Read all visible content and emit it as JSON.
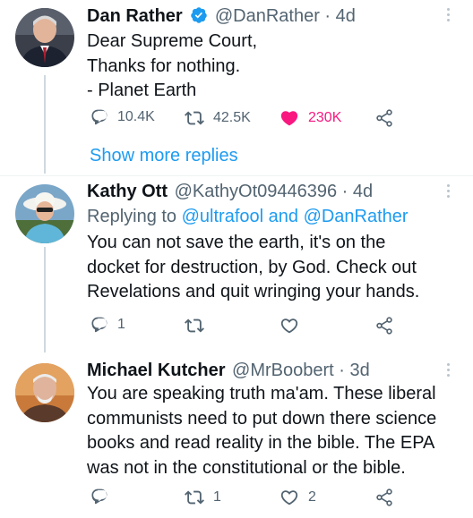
{
  "tweets": [
    {
      "name": "Dan Rather",
      "verified": true,
      "handle": "@DanRather",
      "time": "· 4d",
      "lines": [
        "Dear Supreme Court,",
        "Thanks for nothing.",
        "- Planet Earth"
      ],
      "actions": {
        "reply": "10.4K",
        "retweet": "42.5K",
        "like": "230K"
      },
      "like_active": true
    },
    {
      "name": "Kathy Ott",
      "handle": "@KathyOt09446396",
      "time": "· 4d",
      "replying_prefix": "Replying to",
      "replying_targets": "@ultrafool and @DanRather",
      "lines": [
        "You can not save the earth, it's on the",
        "docket for destruction, by God. Check out",
        "Revelations and quit wringing your hands."
      ],
      "actions": {
        "reply": "1",
        "retweet": "",
        "like": ""
      }
    },
    {
      "name": "Michael Kutcher",
      "handle": "@MrBoobert",
      "time": "· 3d",
      "lines": [
        "You are speaking truth ma'am. These liberal",
        "communists need to put down there science",
        "books and read reality in the bible. The EPA",
        "was not in the constitutional or the bible."
      ],
      "actions": {
        "reply": "",
        "retweet": "1",
        "like": "2"
      }
    }
  ],
  "show_more_replies": "Show more replies",
  "colors": {
    "accent": "#1d9bf0",
    "like_active": "#f91880",
    "muted": "#536471",
    "text": "#0f1419"
  }
}
